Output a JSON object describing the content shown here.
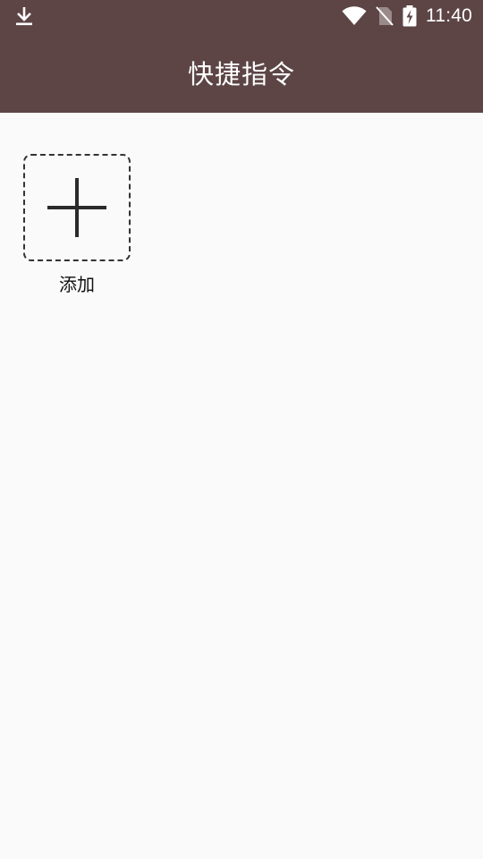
{
  "status_bar": {
    "time": "11:40",
    "icons": [
      "download-icon",
      "wifi-icon",
      "no-sim-icon",
      "battery-charging-icon"
    ],
    "background": "#5d4545"
  },
  "app_bar": {
    "title": "快捷指令",
    "background": "#5d4545"
  },
  "shortcuts": {
    "add_tile": {
      "icon": "plus-icon",
      "label": "添加"
    }
  }
}
